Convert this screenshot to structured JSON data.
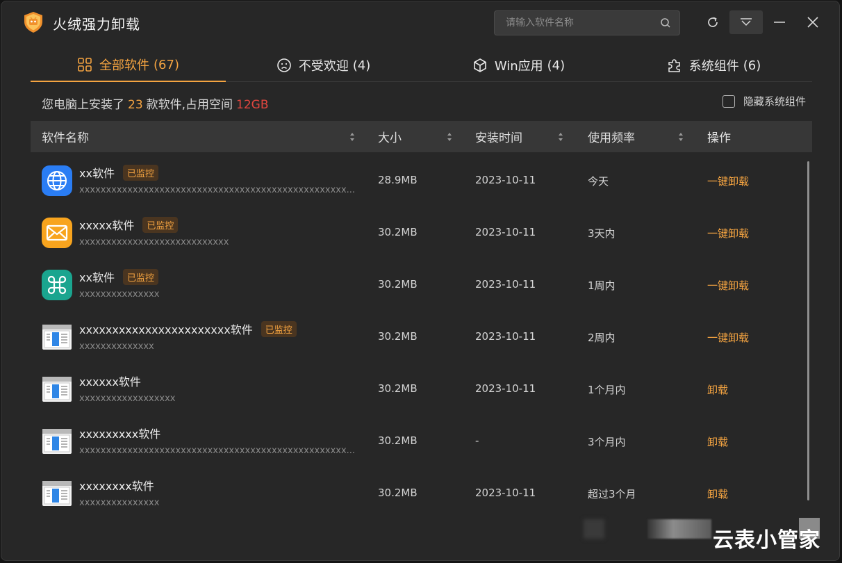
{
  "app": {
    "title": "火绒强力卸载"
  },
  "search": {
    "placeholder": "请输入软件名称"
  },
  "tabs": [
    {
      "label": "全部软件",
      "count": "(67)",
      "icon": "grid-icon",
      "active": true
    },
    {
      "label": "不受欢迎",
      "count": "(4)",
      "icon": "sad-face-icon",
      "active": false
    },
    {
      "label": "Win应用",
      "count": "(4)",
      "icon": "cube-icon",
      "active": false
    },
    {
      "label": "系统组件",
      "count": "(6)",
      "icon": "puzzle-icon",
      "active": false
    }
  ],
  "summary": {
    "prefix": "您电脑上安装了",
    "count": "23",
    "middle": "款软件,占用空间",
    "size": "12GB"
  },
  "hide_system": {
    "label": "隐藏系统组件",
    "checked": false
  },
  "columns": {
    "name": "软件名称",
    "size": "大小",
    "date": "安装时间",
    "freq": "使用频率",
    "op": "操作"
  },
  "rows": [
    {
      "name": "xx软件",
      "badge": "已监控",
      "path": "xxxxxxxxxxxxxxxxxxxxxxxxxxxxxxxxxxxxxxxxxxxxxxxxxx...",
      "size": "28.9MB",
      "date": "2023-10-11",
      "freq": "今天",
      "op": "一键卸载",
      "icon": "globe-icon"
    },
    {
      "name": "xxxxx软件",
      "badge": "已监控",
      "path": "xxxxxxxxxxxxxxxxxxxxxxxxxxxx",
      "size": "30.2MB",
      "date": "2023-10-11",
      "freq": "3天内",
      "op": "一键卸载",
      "icon": "mail-icon"
    },
    {
      "name": "xx软件",
      "badge": "已监控",
      "path": "xxxxxxxxxxxxxxx",
      "size": "30.2MB",
      "date": "2023-10-11",
      "freq": "1周内",
      "op": "一键卸载",
      "icon": "command-icon"
    },
    {
      "name": "xxxxxxxxxxxxxxxxxxxxxxx软件",
      "badge": "已监控",
      "path": "xxxxxxxxxxxxxx",
      "size": "30.2MB",
      "date": "2023-10-11",
      "freq": "2周内",
      "op": "一键卸载",
      "icon": "app-window-icon"
    },
    {
      "name": "xxxxxx软件",
      "badge": "",
      "path": "xxxxxxxxxxxxxxxxxx",
      "size": "30.2MB",
      "date": "2023-10-11",
      "freq": "1个月内",
      "op": "卸载",
      "icon": "app-window-icon"
    },
    {
      "name": "xxxxxxxxx软件",
      "badge": "",
      "path": "xxxxxxxxxxxxxxxxxxxxxxxxxxxxxxxxxxxxxxxxxxxxxxxxxx...",
      "size": "30.2MB",
      "date": "-",
      "freq": "3个月内",
      "op": "卸载",
      "icon": "app-window-icon"
    },
    {
      "name": "xxxxxxxx软件",
      "badge": "",
      "path": "xxxxxxxxxxxxxxx",
      "size": "30.2MB",
      "date": "2023-10-11",
      "freq": "超过3个月",
      "op": "卸载",
      "icon": "app-window-icon"
    }
  ],
  "watermark": "云表小管家",
  "colors": {
    "accent": "#f5a441",
    "danger": "#e0463f",
    "background": "#272727",
    "header": "#373737"
  }
}
